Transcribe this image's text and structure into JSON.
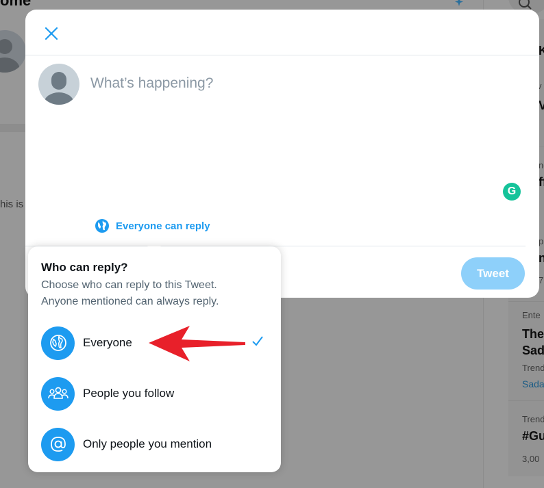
{
  "background": {
    "header_title": "ome",
    "snippet": "his is",
    "trends": {
      "row_a_small": "v",
      "row_a_big": "V",
      "row_b_small": "ne",
      "row_b_big": "ff",
      "row_c_small": "p",
      "row_c_big": "n",
      "row_c_extra": "7",
      "row_d_small": "Ente",
      "row_d_big1": "The",
      "row_d_big2": "Sad",
      "row_d_small2": "Trend",
      "row_d_link": "Sada",
      "row_e_small": "Trend",
      "row_e_big": "#Gu",
      "row_e_small2": "3,00"
    },
    "right_header": "K"
  },
  "compose": {
    "placeholder": "What’s happening?",
    "grammarly_letter": "G",
    "reply_setting_label": "Everyone can reply",
    "tweet_label": "Tweet"
  },
  "reply_menu": {
    "title": "Who can reply?",
    "subtitle_line1": "Choose who can reply to this Tweet.",
    "subtitle_line2": "Anyone mentioned can always reply.",
    "options": [
      {
        "label": "Everyone",
        "icon": "globe-icon",
        "selected": true
      },
      {
        "label": "People you follow",
        "icon": "people-icon",
        "selected": false
      },
      {
        "label": "Only people you mention",
        "icon": "at-sign-icon",
        "selected": false
      }
    ]
  },
  "colors": {
    "accent": "#1d9bf0",
    "tweet_button_disabled": "#8ed0fa",
    "overlay": "#9a9a9a",
    "annotation_arrow": "#e8202a",
    "grammarly": "#15c39a"
  }
}
